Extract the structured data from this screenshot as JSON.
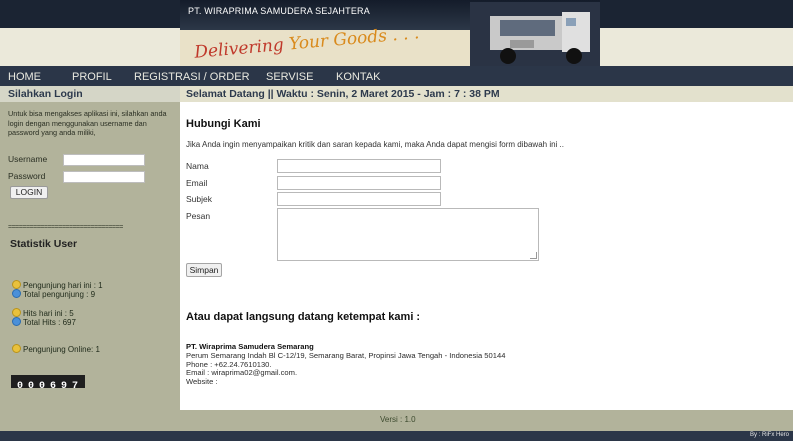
{
  "header": {
    "company": "PT. WIRAPRIMA SAMUDERA SEJAHTERA",
    "slogan_a": "Delivering ",
    "slogan_b": "Your Goods . . ."
  },
  "nav": [
    "HOME",
    "PROFIL",
    "REGISTRASI / ORDER",
    "SERVISE",
    "KONTAK"
  ],
  "sidebar": {
    "title": "Silahkan Login",
    "text": "Untuk bisa mengakses aplikasi ini, silahkan anda login dengan menggunakan username dan password yang anda miliki,",
    "username_label": "Username",
    "password_label": "Password",
    "login_button": "LOGIN",
    "separator": "================================",
    "stats_title": "Statistik User",
    "stats": [
      "Pengunjung hari ini : 1",
      "Total pengunjung : 9",
      "Hits hari ini : 5",
      "Total Hits : 697",
      "Pengunjung Online: 1"
    ],
    "counter": [
      "0",
      "0",
      "0",
      "6",
      "9",
      "7"
    ]
  },
  "info_bar": "Selamat Datang || Waktu : Senin, 2 Maret 2015  - Jam : 7 : 38 PM",
  "contact": {
    "title": "Hubungi Kami",
    "intro": "Jika Anda ingin menyampaikan kritik dan saran kepada kami, maka Anda dapat mengisi form dibawah ini ..",
    "fields": {
      "nama": "Nama",
      "email": "Email",
      "subjek": "Subjek",
      "pesan": "Pesan"
    },
    "submit": "Simpan"
  },
  "visit": {
    "title": "Atau dapat langsung datang ketempat kami :",
    "company": "PT. Wiraprima Samudera Semarang",
    "address": "Perum Semarang Indah Bl C-12/19, Semarang Barat, Propinsi Jawa Tengah - Indonesia 50144",
    "phone": "Phone : +62.24.7610130.",
    "email": "Email : wiraprima02@gmail.com.",
    "website": "Website :"
  },
  "footer": {
    "version": "Versi : 1.0",
    "credit": "By : RiFx Hero"
  },
  "colors": {
    "nav": "#2b3648",
    "sidebar": "#b2b39b",
    "title_text": "#2d3a4d",
    "slogan": "#c0392b"
  },
  "icons": {
    "truck": "truck-image",
    "visitor": "user-icon"
  }
}
